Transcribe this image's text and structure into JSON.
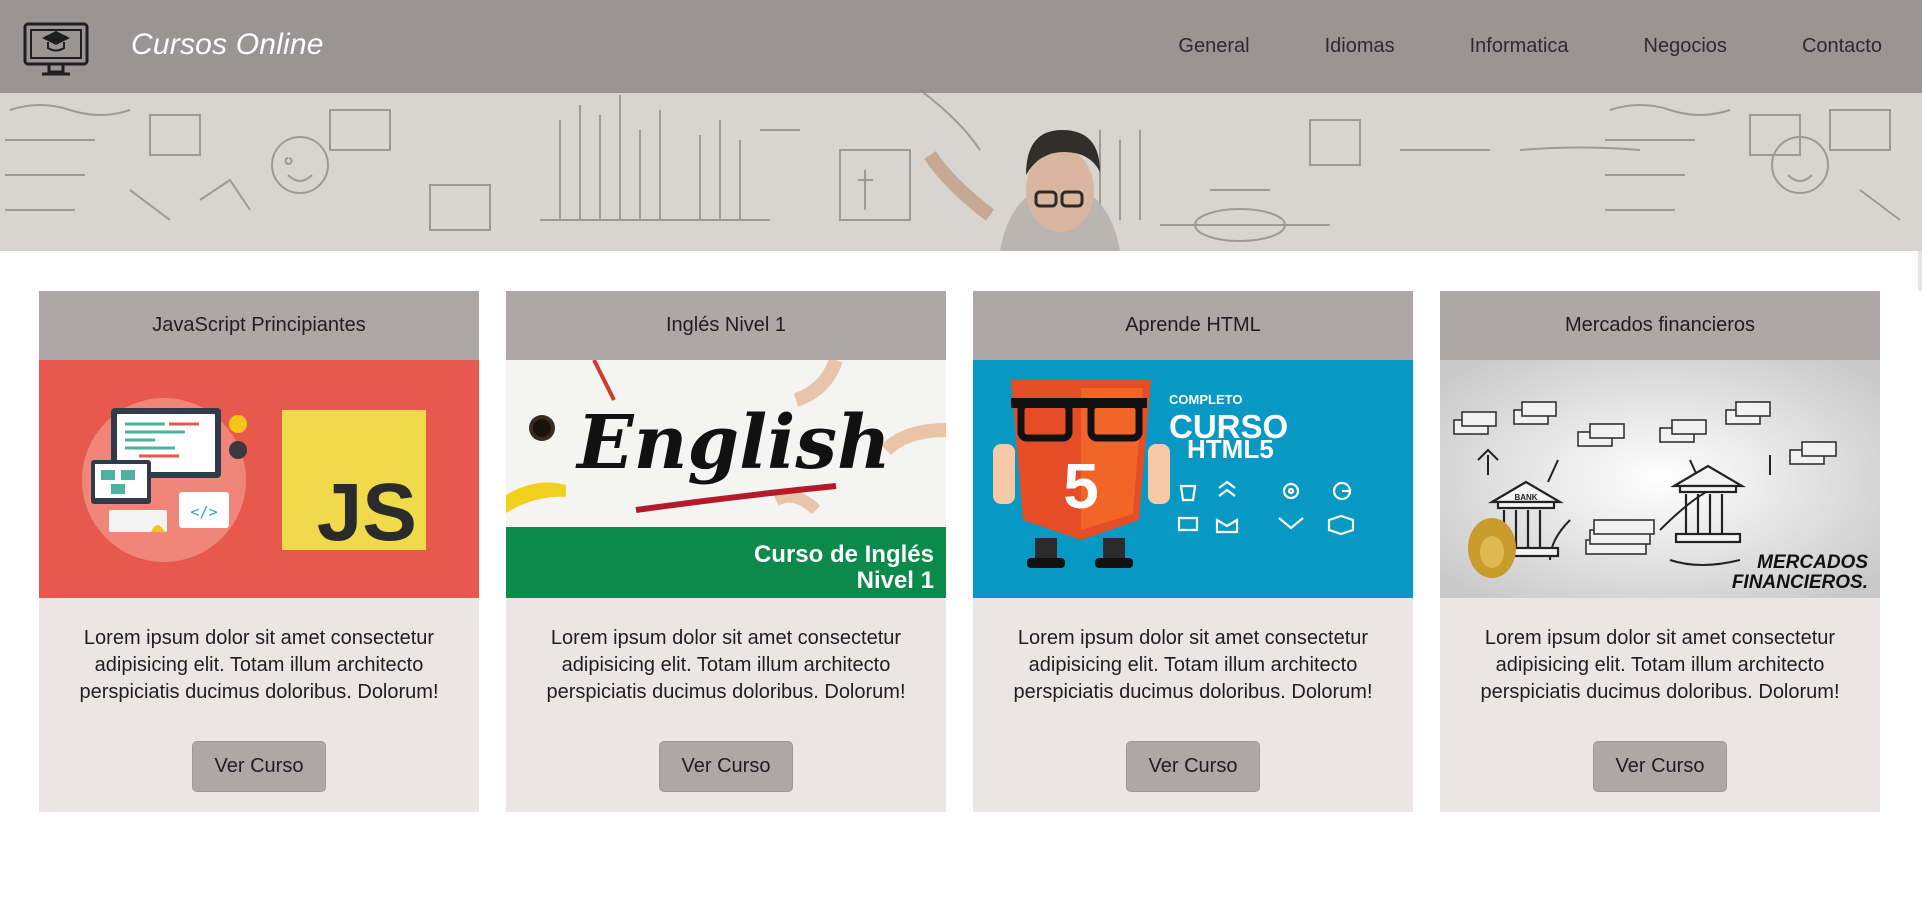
{
  "header": {
    "brand": "Cursos Online",
    "logo_icon": "computer-graduation-cap-icon",
    "nav": [
      "General",
      "Idiomas",
      "Informatica",
      "Negocios",
      "Contacto"
    ]
  },
  "cards": [
    {
      "title": "JavaScript Principiantes",
      "image": {
        "badge": "JS",
        "bg": "#e6594c"
      },
      "text": "Lorem ipsum dolor sit amet consectetur adipisicing elit. Totam illum architecto perspiciatis ducimus doloribus. Dolorum!",
      "button": "Ver Curso"
    },
    {
      "title": "Inglés Nivel 1",
      "image": {
        "headline": "English",
        "line1": "Curso de Inglés",
        "line2": "Nivel 1",
        "bg": "#0b8a4c"
      },
      "text": "Lorem ipsum dolor sit amet consectetur adipisicing elit. Totam illum architecto perspiciatis ducimus doloribus. Dolorum!",
      "button": "Ver Curso"
    },
    {
      "title": "Aprende HTML",
      "image": {
        "small": "COMPLETO",
        "big": "CURSO",
        "sub": "HTML5",
        "shield": "5",
        "bg": "#0898c4"
      },
      "text": "Lorem ipsum dolor sit amet consectetur adipisicing elit. Totam illum architecto perspiciatis ducimus doloribus. Dolorum!",
      "button": "Ver Curso"
    },
    {
      "title": "Mercados financieros",
      "image": {
        "line1": "MERCADOS",
        "line2": "FINANCIEROS.",
        "bank": "BANK"
      },
      "text": "Lorem ipsum dolor sit amet consectetur adipisicing elit. Totam illum architecto perspiciatis ducimus doloribus. Dolorum!",
      "button": "Ver Curso"
    }
  ],
  "colors": {
    "topbar": "#8c8687",
    "card_header": "#aea6a7",
    "card_body": "#ece5e5",
    "button": "#aea6a7"
  }
}
